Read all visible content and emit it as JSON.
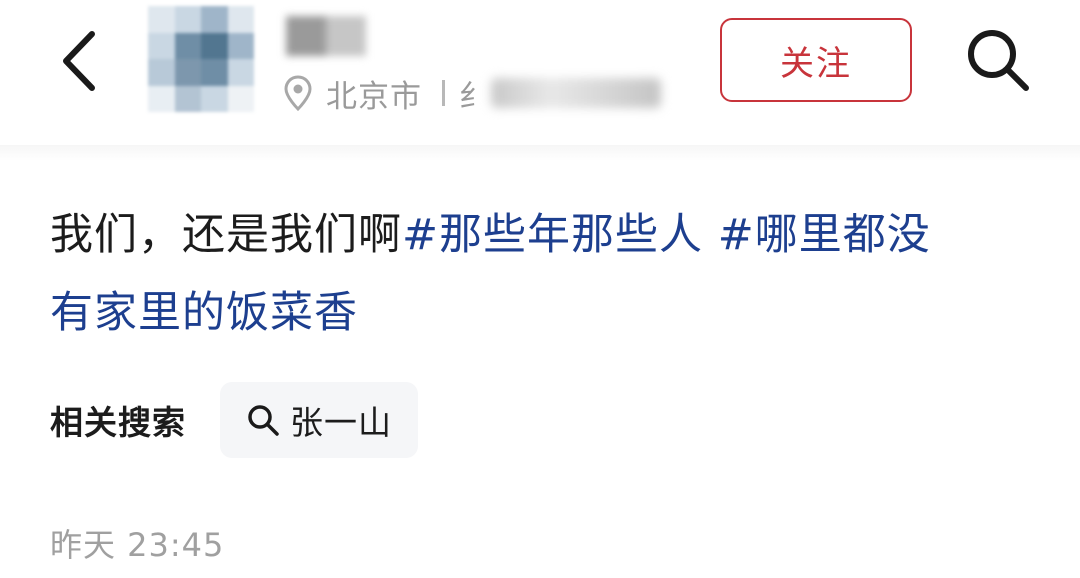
{
  "header": {
    "back_icon": "chevron-left-icon",
    "avatar": {
      "blurred": true,
      "colors": [
        "#c9d7e3",
        "#9fb5c9",
        "#6f8ea6",
        "#dfe7ee"
      ]
    },
    "location": {
      "icon": "location-pin-icon",
      "city": "北京市",
      "detail_blurred": true,
      "partial": "纟"
    },
    "follow_label": "关注",
    "follow_color": "#c8343b",
    "search_icon": "search-icon"
  },
  "post": {
    "text_plain": "我们，还是我们啊",
    "hashtags": [
      "#那些年那些人",
      "#哪里都没有家里的饭菜香"
    ],
    "hashtag_line1": "#那些年那些人 #哪里都没",
    "hashtag_line2": "有家里的饭菜香",
    "hashtag_color": "#1d3f8f"
  },
  "related_search": {
    "label": "相关搜索",
    "chips": [
      {
        "icon": "search-icon",
        "text": "张一山"
      }
    ]
  },
  "timestamp": "昨天 23:45"
}
